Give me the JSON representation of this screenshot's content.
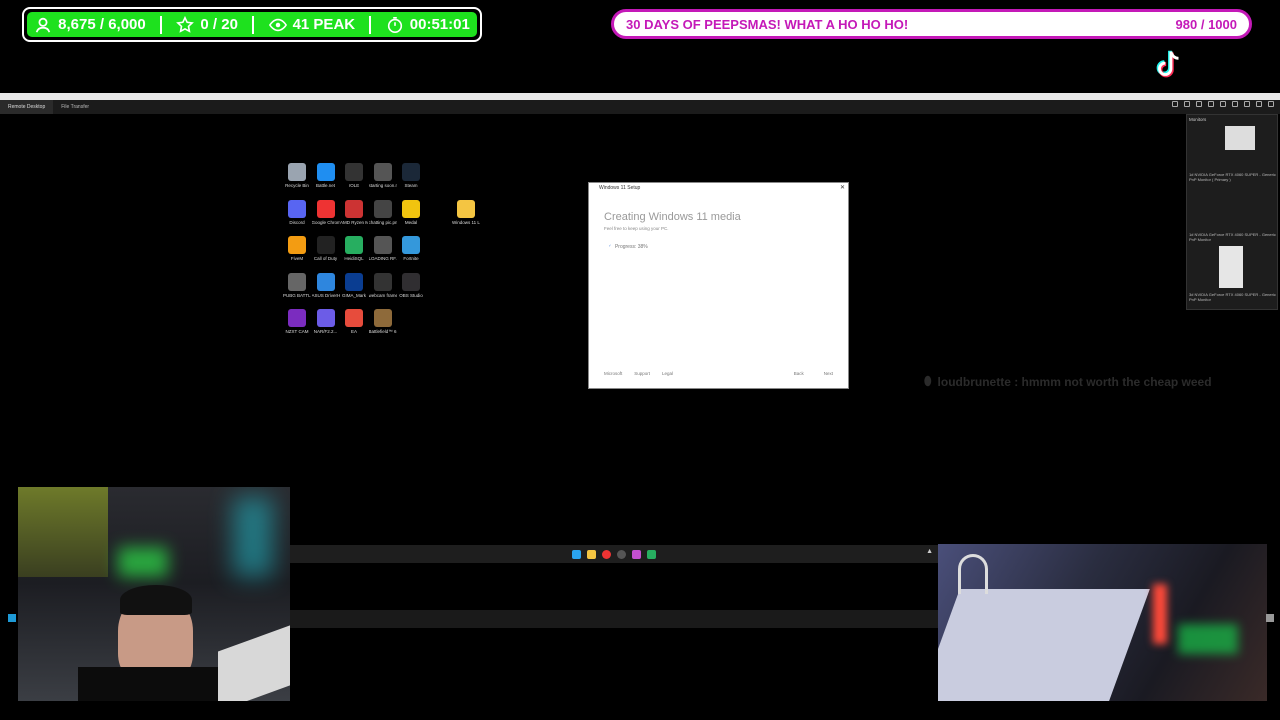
{
  "stats": {
    "followers": "8,675 / 6,000",
    "subs": "0 / 20",
    "peak": "41 PEAK",
    "timer": "00:51:01"
  },
  "goal": {
    "title": "30 DAYS OF PEEPSMAS! WHAT A HO HO HO!",
    "count": "980 / 1000"
  },
  "remote": {
    "tabs": [
      "Remote Desktop",
      "File Transfer"
    ]
  },
  "desktop_icons": [
    {
      "label": "Recycle Bin",
      "color": "#9aa4b0"
    },
    {
      "label": "Battle.net",
      "color": "#1f8ef1"
    },
    {
      "label": "rOLE",
      "color": "#333"
    },
    {
      "label": "starting soon.mp4",
      "color": "#555"
    },
    {
      "label": "Steam",
      "color": "#1b2838"
    },
    {
      "label": "Discord",
      "color": "#5865f2"
    },
    {
      "label": "Google Chrome",
      "color": "#e33"
    },
    {
      "label": "AMD Ryzen Master",
      "color": "#c33"
    },
    {
      "label": "chatting pic.png",
      "color": "#444"
    },
    {
      "label": "Medal",
      "color": "#f1c40f"
    },
    {
      "label": "FiveM",
      "color": "#f39c12"
    },
    {
      "label": "Call of Duty",
      "color": "#222"
    },
    {
      "label": "HeidiSQL",
      "color": "#27ae60"
    },
    {
      "label": "LOADING RF.mp4",
      "color": "#555"
    },
    {
      "label": "Fortnite",
      "color": "#3498db"
    },
    {
      "label": "PUBG BATTLEGR...",
      "color": "#666"
    },
    {
      "label": "ASUS DriverHub",
      "color": "#2e86de"
    },
    {
      "label": "GIMA_Mark",
      "color": "#0a3d91"
    },
    {
      "label": "webcam frame.png",
      "color": "#333"
    },
    {
      "label": "OBS Studio",
      "color": "#302e31"
    },
    {
      "label": "NZXT CAM",
      "color": "#7b2cbf"
    },
    {
      "label": "NAR/F2.2...",
      "color": "#6c5ce7"
    },
    {
      "label": "EA",
      "color": "#e74c3c"
    },
    {
      "label": "Battlefield™ 6",
      "color": "#8e6a3a"
    }
  ],
  "folder_icon": {
    "label": "Windows 11 License Key...",
    "color": "#f4c542"
  },
  "setup": {
    "window_title": "Windows 11 Setup",
    "heading": "Creating Windows 11 media",
    "subtitle": "Feel free to keep using your PC.",
    "progress": "Progress: 38%",
    "footer_brand": "Microsoft",
    "footer_support": "Support",
    "footer_legal": "Legal",
    "back": "Back",
    "next": "Next"
  },
  "monitors": {
    "title": "Monitors",
    "items": [
      "1# NVIDIA GeForce RTX 4060 SUPER - Generic PnP Monitor ( Primary )",
      "1# NVIDIA GeForce RTX 4060 SUPER - Generic PnP Monitor",
      "3# NVIDIA GeForce RTX 4060 SUPER - Generic PnP Monitor"
    ]
  },
  "chat": {
    "message": "loudbrunette : hmmm not worth the cheap weed"
  }
}
